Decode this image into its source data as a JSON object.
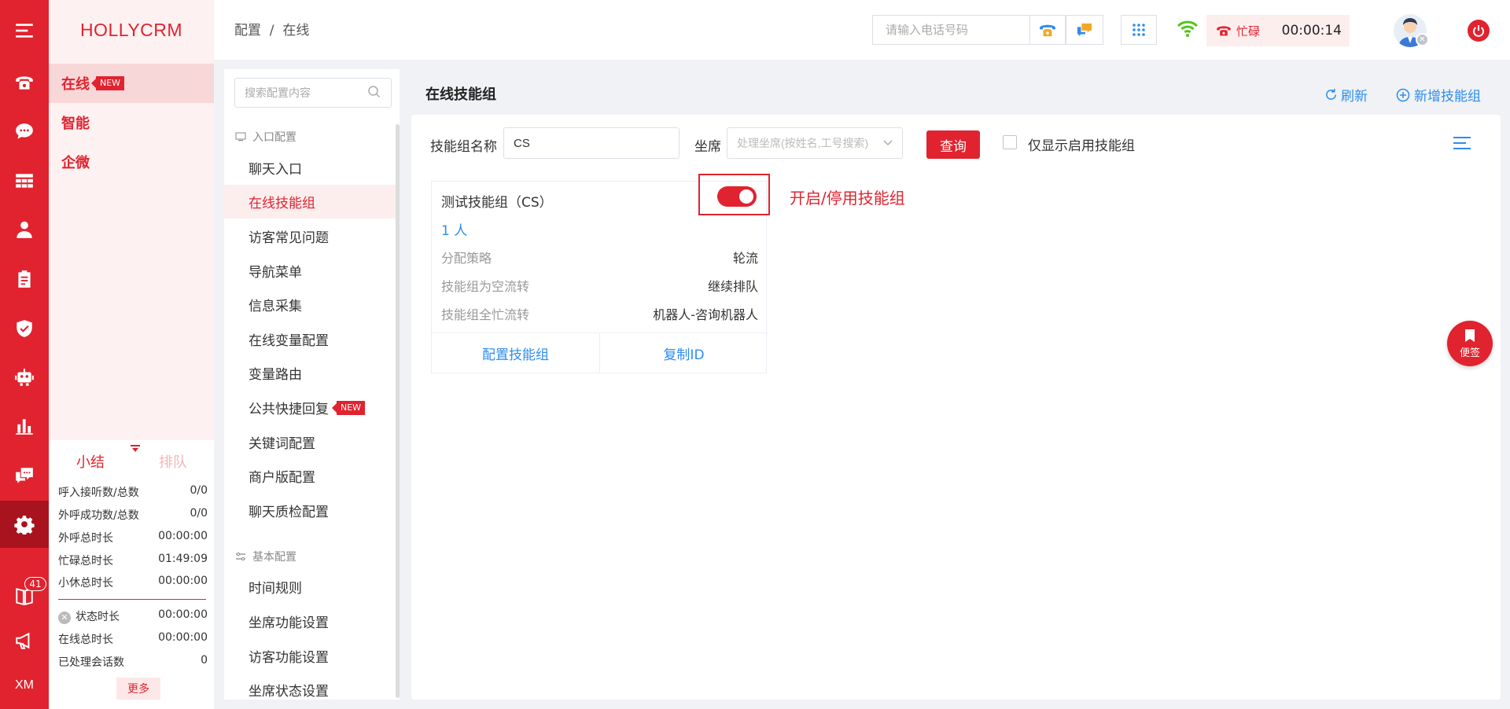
{
  "brand": "HOLLYCRM",
  "menu": {
    "items": [
      {
        "label": "在线",
        "tag": "NEW"
      },
      {
        "label": "智能"
      },
      {
        "label": "企微"
      }
    ]
  },
  "stats": {
    "tab_summary": "小结",
    "tab_queue": "排队",
    "rows": [
      {
        "label": "呼入接听数/总数",
        "value": "0/0"
      },
      {
        "label": "外呼成功数/总数",
        "value": "0/0"
      },
      {
        "label": "外呼总时长",
        "value": "00:00:00"
      },
      {
        "label": "忙碌总时长",
        "value": "01:49:09"
      },
      {
        "label": "小休总时长",
        "value": "00:00:00"
      }
    ],
    "rows2": [
      {
        "label": "状态时长",
        "value": "00:00:00"
      },
      {
        "label": "在线总时长",
        "value": "00:00:00"
      },
      {
        "label": "已处理会话数",
        "value": "0"
      }
    ],
    "more": "更多"
  },
  "rail": {
    "badge": "41",
    "xm": "XM"
  },
  "topbar": {
    "breadcrumb": "配置  /  在线",
    "phone_placeholder": "请输入电话号码",
    "status": "忙碌",
    "timer": "00:00:14"
  },
  "confnav": {
    "search_placeholder": "搜索配置内容",
    "group1": "入口配置",
    "items1": [
      "聊天入口",
      "在线技能组",
      "访客常见问题",
      "导航菜单",
      "信息采集",
      "在线变量配置",
      "变量路由",
      "公共快捷回复",
      "关键词配置",
      "商户版配置",
      "聊天质检配置"
    ],
    "new_tag": "NEW",
    "group2": "基本配置",
    "items2": [
      "时间规则",
      "坐席功能设置",
      "访客功能设置",
      "坐席状态设置"
    ]
  },
  "main": {
    "title": "在线技能组",
    "refresh": "刷新",
    "add": "新增技能组",
    "filter": {
      "name_label": "技能组名称",
      "name_value": "CS",
      "agent_label": "坐席",
      "agent_placeholder": "处理坐席(按姓名,工号搜索)",
      "query": "查询",
      "only_enabled": "仅显示启用技能组"
    },
    "card": {
      "title": "测试技能组（CS）",
      "count": "1 人",
      "rows": [
        {
          "k": "分配策略",
          "v": "轮流"
        },
        {
          "k": "技能组为空流转",
          "v": "继续排队"
        },
        {
          "k": "技能组全忙流转",
          "v": "机器人-咨询机器人"
        }
      ],
      "config": "配置技能组",
      "copy": "复制ID"
    },
    "annotation": "开启/停用技能组",
    "sticky": "便签"
  },
  "colors": {
    "accent": "#e0232f",
    "link": "#2d8cf0"
  }
}
